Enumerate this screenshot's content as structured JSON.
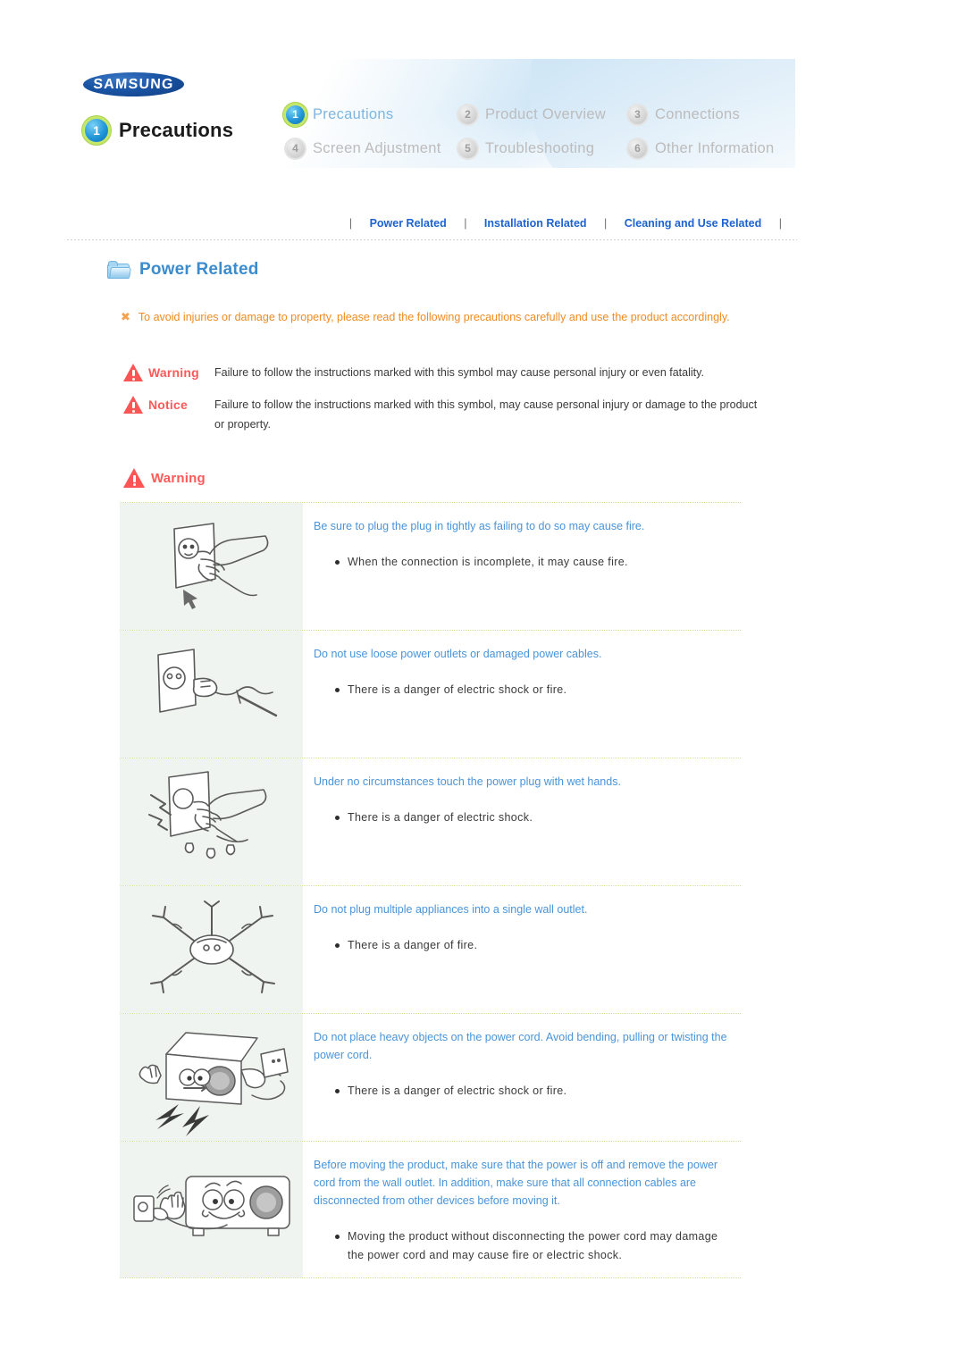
{
  "header": {
    "brand": "SAMSUNG",
    "section_badge": "1",
    "section_title": "Precautions",
    "nav_items": [
      {
        "num": "1",
        "label": "Precautions",
        "selected": true
      },
      {
        "num": "2",
        "label": "Product Overview",
        "selected": false
      },
      {
        "num": "3",
        "label": "Connections",
        "selected": false
      },
      {
        "num": "4",
        "label": "Screen Adjustment",
        "selected": false
      },
      {
        "num": "5",
        "label": "Troubleshooting",
        "selected": false
      },
      {
        "num": "6",
        "label": "Other Information",
        "selected": false
      }
    ]
  },
  "subnav": {
    "separator": "|",
    "links": [
      {
        "label": "Power Related"
      },
      {
        "label": "Installation Related"
      },
      {
        "label": "Cleaning and Use Related"
      }
    ]
  },
  "section": {
    "icon": "folder-icon",
    "title": "Power Related",
    "intro_marker": "✖",
    "intro_text": "To avoid injuries or damage to property, please read the following precautions carefully and use the product accordingly."
  },
  "definitions": [
    {
      "label": "Warning",
      "text": "Failure to follow the instructions marked with this symbol may cause personal injury or even fatality."
    },
    {
      "label": "Notice",
      "text": "Failure to follow the instructions marked with this symbol, may cause personal injury or damage to the product or property."
    }
  ],
  "warning_block": {
    "label": "Warning",
    "rows": [
      {
        "image": "hand-plugging-plug-into-outlet-illustration",
        "headline": "Be sure to plug the plug in tightly as failing to do so may cause fire.",
        "bullets": [
          "When the connection is incomplete, it may cause fire."
        ]
      },
      {
        "image": "loose-outlet-damaged-cable-illustration",
        "headline": "Do not use loose power outlets or damaged power cables.",
        "bullets": [
          "There is a danger of electric shock or fire."
        ]
      },
      {
        "image": "wet-hand-touching-plug-illustration",
        "headline": "Under no circumstances touch the power plug with wet hands.",
        "bullets": [
          "There is a danger of electric shock."
        ]
      },
      {
        "image": "multiple-plugs-single-outlet-illustration",
        "headline": "Do not plug multiple appliances into a single wall outlet.",
        "bullets": [
          "There is a danger of fire."
        ]
      },
      {
        "image": "projector-on-damaged-power-cord-illustration",
        "headline": "Do not place heavy objects on the power cord. Avoid bending, pulling or twisting the power cord.",
        "bullets": [
          "There is a danger of electric shock or fire."
        ]
      },
      {
        "image": "projector-unplugged-before-moving-illustration",
        "headline": "Before moving the product, make sure that the power is off and remove the power cord from the wall outlet. In addition, make sure that all connection cables are disconnected from other devices before moving it.",
        "bullets": [
          "Moving the product without disconnecting the power cord may damage the power cord and may cause fire or electric shock."
        ]
      }
    ]
  },
  "colors": {
    "link_blue": "#1e62d0",
    "headline_blue": "#4a94d8",
    "section_title_blue": "#3c8ccd",
    "warning_red": "#fb5a5a",
    "intro_orange": "#ef8c22",
    "row_divider_green": "#cfe39a",
    "image_panel_bg": "#eff4f0"
  }
}
